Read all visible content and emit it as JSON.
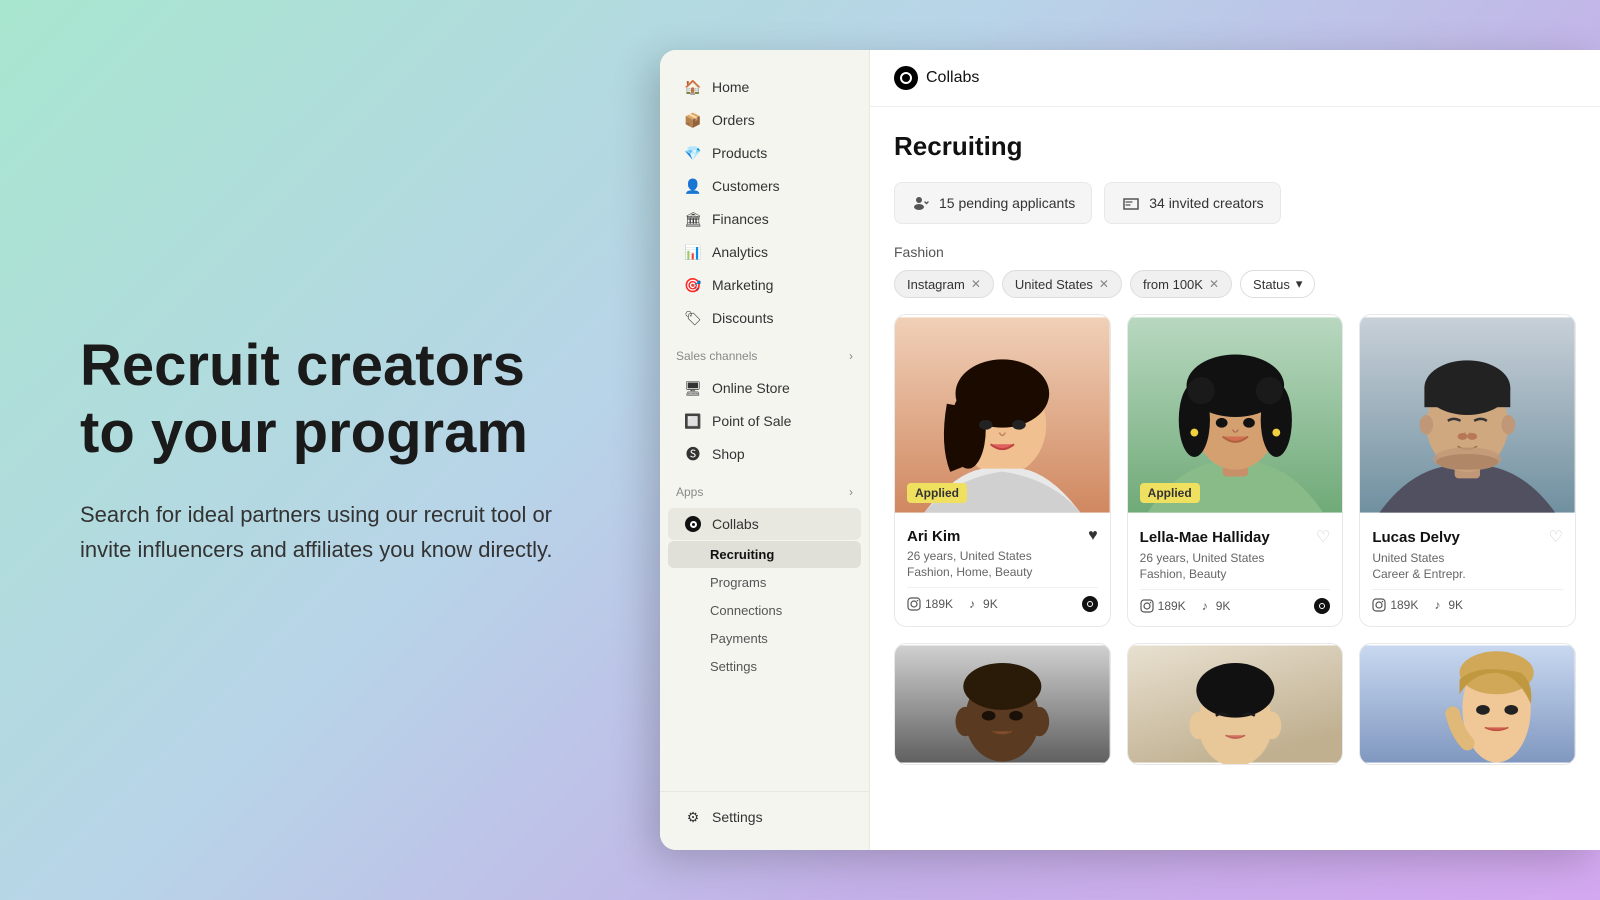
{
  "background": {
    "gradient": "linear-gradient(135deg, #a8e6cf 0%, #b8d4e8 40%, #c4b0e8 70%, #d4a8f0 100%)"
  },
  "hero": {
    "title": "Recruit creators\nto your program",
    "subtitle": "Search for ideal partners using our recruit tool or invite influencers and affiliates you know directly."
  },
  "app": {
    "name": "Collabs"
  },
  "sidebar": {
    "main_items": [
      {
        "id": "home",
        "label": "Home",
        "icon": "🏠"
      },
      {
        "id": "orders",
        "label": "Orders",
        "icon": "📦"
      },
      {
        "id": "products",
        "label": "Products",
        "icon": "💎"
      },
      {
        "id": "customers",
        "label": "Customers",
        "icon": "👤"
      },
      {
        "id": "finances",
        "label": "Finances",
        "icon": "🏛"
      },
      {
        "id": "analytics",
        "label": "Analytics",
        "icon": "📊"
      },
      {
        "id": "marketing",
        "label": "Marketing",
        "icon": "🎯"
      },
      {
        "id": "discounts",
        "label": "Discounts",
        "icon": "🏷"
      }
    ],
    "sales_channels_label": "Sales channels",
    "sales_channels": [
      {
        "id": "online-store",
        "label": "Online Store",
        "icon": "🖥"
      },
      {
        "id": "point-of-sale",
        "label": "Point of Sale",
        "icon": "🔲"
      },
      {
        "id": "shop",
        "label": "Shop",
        "icon": "🅢"
      }
    ],
    "apps_label": "Apps",
    "apps": [
      {
        "id": "collabs",
        "label": "Collabs",
        "icon": "⊙"
      }
    ],
    "collabs_sub": [
      {
        "id": "recruiting",
        "label": "Recruiting",
        "active": true
      },
      {
        "id": "programs",
        "label": "Programs"
      },
      {
        "id": "connections",
        "label": "Connections"
      },
      {
        "id": "payments",
        "label": "Payments"
      },
      {
        "id": "settings",
        "label": "Settings"
      }
    ],
    "bottom": [
      {
        "id": "settings",
        "label": "Settings",
        "icon": "⚙"
      }
    ]
  },
  "main": {
    "page_title": "Recruiting",
    "stats": [
      {
        "id": "pending",
        "icon": "👥",
        "label": "15 pending applicants"
      },
      {
        "id": "invited",
        "icon": "💬",
        "label": "34 invited creators"
      }
    ],
    "active_filters": {
      "category": "Fashion",
      "tags": [
        {
          "id": "instagram",
          "label": "Instagram"
        },
        {
          "id": "us",
          "label": "United States"
        },
        {
          "id": "100k",
          "label": "from 100K"
        },
        {
          "id": "status",
          "label": "Status",
          "has_arrow": true
        }
      ]
    },
    "creators": [
      {
        "id": "ari-kim",
        "name": "Ari Kim",
        "age": "26 years",
        "country": "United States",
        "niches": "Fashion, Home, Beauty",
        "instagram": "189K",
        "tiktok": "9K",
        "applied": true,
        "liked": true,
        "color_top": "#f5d0c0",
        "color_bottom": "#d4906a"
      },
      {
        "id": "lella-mae-halliday",
        "name": "Lella-Mae Halliday",
        "age": "26 years",
        "country": "United States",
        "niches": "Fashion, Beauty",
        "instagram": "189K",
        "tiktok": "9K",
        "applied": true,
        "liked": false,
        "color_top": "#b8d8b0",
        "color_bottom": "#6aaa6a"
      },
      {
        "id": "lucas-delvy",
        "name": "Lucas Delvy",
        "age": "",
        "country": "United States",
        "niches": "Career & Entrepr.",
        "instagram": "189K",
        "tiktok": "9K",
        "applied": false,
        "liked": false,
        "color_top": "#c0ccd8",
        "color_bottom": "#7090a8"
      }
    ]
  }
}
